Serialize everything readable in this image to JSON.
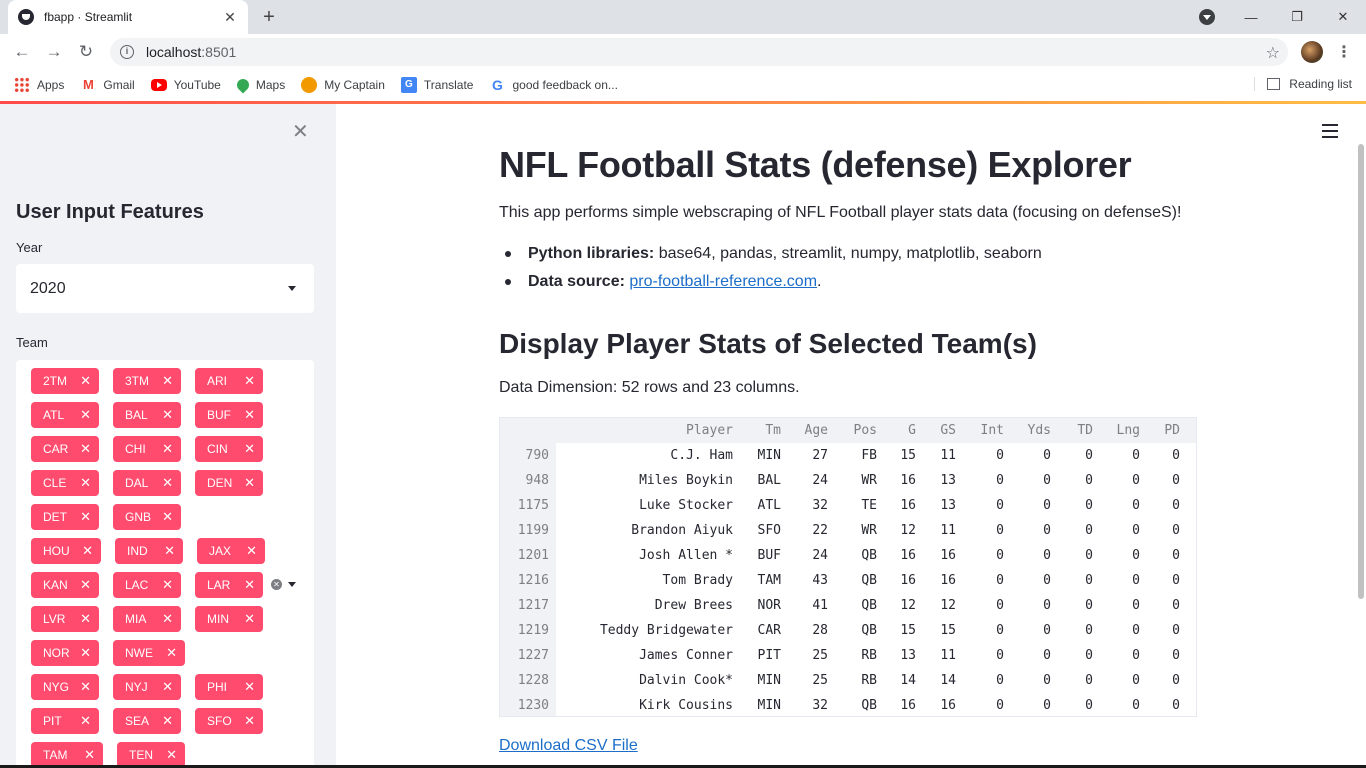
{
  "browser": {
    "tab_title": "fbapp · Streamlit",
    "url_host": "localhost",
    "url_port": ":8501",
    "bookmarks": [
      {
        "label": "Apps",
        "icon": "apps-grid-icon"
      },
      {
        "label": "Gmail",
        "icon": "gmail-icon"
      },
      {
        "label": "YouTube",
        "icon": "youtube-icon"
      },
      {
        "label": "Maps",
        "icon": "maps-icon"
      },
      {
        "label": "My Captain",
        "icon": "mycaptain-icon"
      },
      {
        "label": "Translate",
        "icon": "translate-icon"
      },
      {
        "label": "good feedback on...",
        "icon": "google-icon"
      }
    ],
    "reading_list": "Reading list"
  },
  "sidebar": {
    "header": "User Input Features",
    "year_label": "Year",
    "year_value": "2020",
    "team_label": "Team",
    "teams": [
      "2TM",
      "3TM",
      "ARI",
      "ATL",
      "BAL",
      "BUF",
      "CAR",
      "CHI",
      "CIN",
      "CLE",
      "DAL",
      "DEN",
      "DET",
      "GNB",
      "HOU",
      "IND",
      "JAX",
      "KAN",
      "LAC",
      "LAR",
      "LVR",
      "MIA",
      "MIN",
      "NOR",
      "NWE",
      "NYG",
      "NYJ",
      "PHI",
      "PIT",
      "SEA",
      "SFO",
      "TAM",
      "TEN"
    ]
  },
  "main": {
    "title": "NFL Football Stats (defense) Explorer",
    "intro": "This app performs simple webscraping of NFL Football player stats data (focusing on defenseS)!",
    "bullet1_label": "Python libraries:",
    "bullet1_text": " base64, pandas, streamlit, numpy, matplotlib, seaborn",
    "bullet2_label": "Data source:",
    "bullet2_link": "pro-football-reference.com",
    "bullet2_tail": ".",
    "subheader": "Display Player Stats of Selected Team(s)",
    "dimension": "Data Dimension: 52 rows and 23 columns.",
    "download": "Download CSV File"
  },
  "table": {
    "columns": [
      "Player",
      "Tm",
      "Age",
      "Pos",
      "G",
      "GS",
      "Int",
      "Yds",
      "TD",
      "Lng",
      "PD"
    ],
    "rows": [
      {
        "index": "790",
        "cells": [
          "C.J. Ham",
          "MIN",
          "27",
          "FB",
          "15",
          "11",
          "0",
          "0",
          "0",
          "0",
          "0"
        ]
      },
      {
        "index": "948",
        "cells": [
          "Miles Boykin",
          "BAL",
          "24",
          "WR",
          "16",
          "13",
          "0",
          "0",
          "0",
          "0",
          "0"
        ]
      },
      {
        "index": "1175",
        "cells": [
          "Luke Stocker",
          "ATL",
          "32",
          "TE",
          "16",
          "13",
          "0",
          "0",
          "0",
          "0",
          "0"
        ]
      },
      {
        "index": "1199",
        "cells": [
          "Brandon Aiyuk",
          "SFO",
          "22",
          "WR",
          "12",
          "11",
          "0",
          "0",
          "0",
          "0",
          "0"
        ]
      },
      {
        "index": "1201",
        "cells": [
          "Josh Allen *",
          "BUF",
          "24",
          "QB",
          "16",
          "16",
          "0",
          "0",
          "0",
          "0",
          "0"
        ]
      },
      {
        "index": "1216",
        "cells": [
          "Tom Brady",
          "TAM",
          "43",
          "QB",
          "16",
          "16",
          "0",
          "0",
          "0",
          "0",
          "0"
        ]
      },
      {
        "index": "1217",
        "cells": [
          "Drew Brees",
          "NOR",
          "41",
          "QB",
          "12",
          "12",
          "0",
          "0",
          "0",
          "0",
          "0"
        ]
      },
      {
        "index": "1219",
        "cells": [
          "Teddy Bridgewater",
          "CAR",
          "28",
          "QB",
          "15",
          "15",
          "0",
          "0",
          "0",
          "0",
          "0"
        ]
      },
      {
        "index": "1227",
        "cells": [
          "James Conner",
          "PIT",
          "25",
          "RB",
          "13",
          "11",
          "0",
          "0",
          "0",
          "0",
          "0"
        ]
      },
      {
        "index": "1228",
        "cells": [
          "Dalvin Cook*",
          "MIN",
          "25",
          "RB",
          "14",
          "14",
          "0",
          "0",
          "0",
          "0",
          "0"
        ]
      },
      {
        "index": "1230",
        "cells": [
          "Kirk Cousins",
          "MIN",
          "32",
          "QB",
          "16",
          "16",
          "0",
          "0",
          "0",
          "0",
          "0"
        ]
      }
    ]
  },
  "colors": {
    "accent": "#ff4b4b",
    "chip": "#ff4b6e",
    "link": "#1c6ec9",
    "sidebar_bg": "#f0f2f6"
  }
}
